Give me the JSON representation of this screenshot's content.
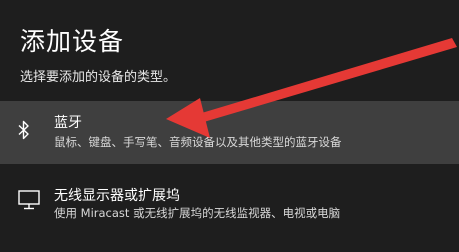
{
  "dialog": {
    "title": "添加设备",
    "subtitle": "选择要添加的设备的类型。"
  },
  "options": [
    {
      "icon": "bluetooth-icon",
      "label": "蓝牙",
      "description": "鼠标、键盘、手写笔、音频设备以及其他类型的蓝牙设备",
      "highlighted": true
    },
    {
      "icon": "monitor-icon",
      "label": "无线显示器或扩展坞",
      "description": "使用 Miracast 或无线扩展坞的无线监视器、电视或电脑",
      "highlighted": false
    }
  ],
  "colors": {
    "background": "#1e1e1e",
    "highlight": "#3f3f3f",
    "annotation_arrow": "#e53935"
  }
}
